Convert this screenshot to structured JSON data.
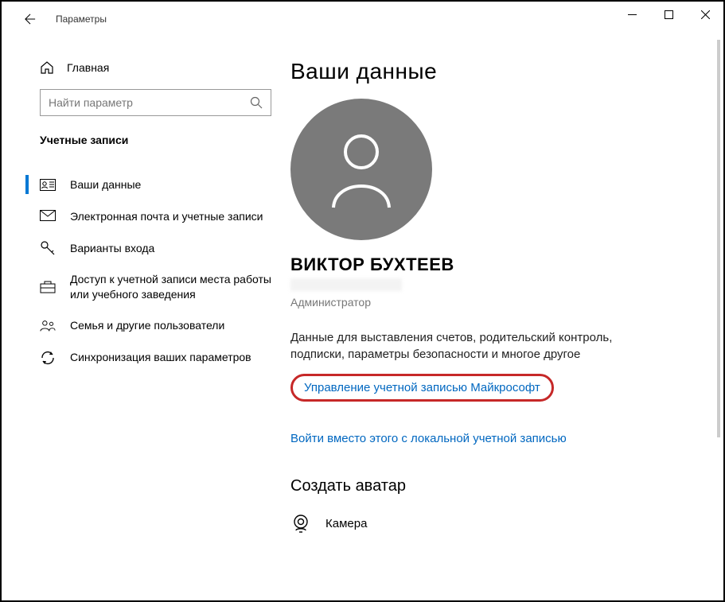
{
  "window": {
    "title": "Параметры"
  },
  "sidebar": {
    "home_label": "Главная",
    "search_placeholder": "Найти параметр",
    "category_label": "Учетные записи",
    "items": [
      {
        "label": "Ваши данные",
        "icon": "person-card-icon"
      },
      {
        "label": "Электронная почта и учетные записи",
        "icon": "mail-icon"
      },
      {
        "label": "Варианты входа",
        "icon": "key-icon"
      },
      {
        "label": "Доступ к учетной записи места работы или учебного заведения",
        "icon": "briefcase-icon"
      },
      {
        "label": "Семья и другие пользователи",
        "icon": "people-icon"
      },
      {
        "label": "Синхронизация ваших параметров",
        "icon": "sync-icon"
      }
    ]
  },
  "main": {
    "page_title": "Ваши данные",
    "user_name": "ВИКТОР БУХТЕЕВ",
    "role": "Администратор",
    "description": "Данные для выставления счетов, родительский контроль, подписки, параметры безопасности и многое другое",
    "manage_link": "Управление учетной записью Майкрософт",
    "local_login_link": "Войти вместо этого с локальной учетной записью",
    "avatar_section_title": "Создать аватар",
    "camera_label": "Камера"
  }
}
